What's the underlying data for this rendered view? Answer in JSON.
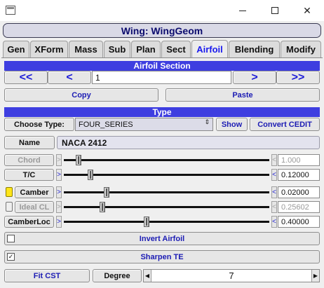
{
  "window": {
    "minimize_glyph": "—",
    "maximize_glyph": "☐",
    "close_glyph": "✕"
  },
  "header": {
    "title": "Wing: WingGeom"
  },
  "tabs": [
    {
      "label": "Gen"
    },
    {
      "label": "XForm"
    },
    {
      "label": "Mass"
    },
    {
      "label": "Sub"
    },
    {
      "label": "Plan"
    },
    {
      "label": "Sect"
    },
    {
      "label": "Airfoil",
      "active": true
    },
    {
      "label": "Blending"
    },
    {
      "label": "Modify"
    }
  ],
  "airfoil_section": {
    "title": "Airfoil Section",
    "first_label": "<<",
    "prev_label": "<",
    "index": "1",
    "next_label": ">",
    "last_label": ">>",
    "copy_label": "Copy",
    "paste_label": "Paste"
  },
  "type_section": {
    "title": "Type",
    "choose_label": "Choose Type:",
    "selected_type": "FOUR_SERIES",
    "show_label": "Show",
    "convert_label": "Convert CEDIT",
    "name_label": "Name",
    "name_value": "NACA 2412"
  },
  "params": [
    {
      "label": "Chord",
      "value": "1.000",
      "enabled": false,
      "fraction": 0.06
    },
    {
      "label": "T/C",
      "value": "0.12000",
      "enabled": true,
      "fraction": 0.12
    },
    {
      "label": "Camber",
      "value": "0.02000",
      "enabled": true,
      "fraction": 0.2,
      "toggle": "on"
    },
    {
      "label": "Ideal CL",
      "value": "0.25602",
      "enabled": false,
      "fraction": 0.18,
      "toggle": "off"
    },
    {
      "label": "CamberLoc",
      "value": "0.40000",
      "enabled": true,
      "fraction": 0.4
    }
  ],
  "slider_arrows": {
    "left": ">",
    "right": "<"
  },
  "toggles": {
    "invert_label": "Invert Airfoil",
    "invert_checked": false,
    "sharpen_label": "Sharpen TE",
    "sharpen_checked": true,
    "check_glyph": "✓"
  },
  "fit": {
    "fit_cst_label": "Fit CST",
    "degree_label": "Degree",
    "degree_value": "7",
    "dec_glyph": "◀",
    "inc_glyph": "▶"
  },
  "dropdown_arrows": "⇕"
}
